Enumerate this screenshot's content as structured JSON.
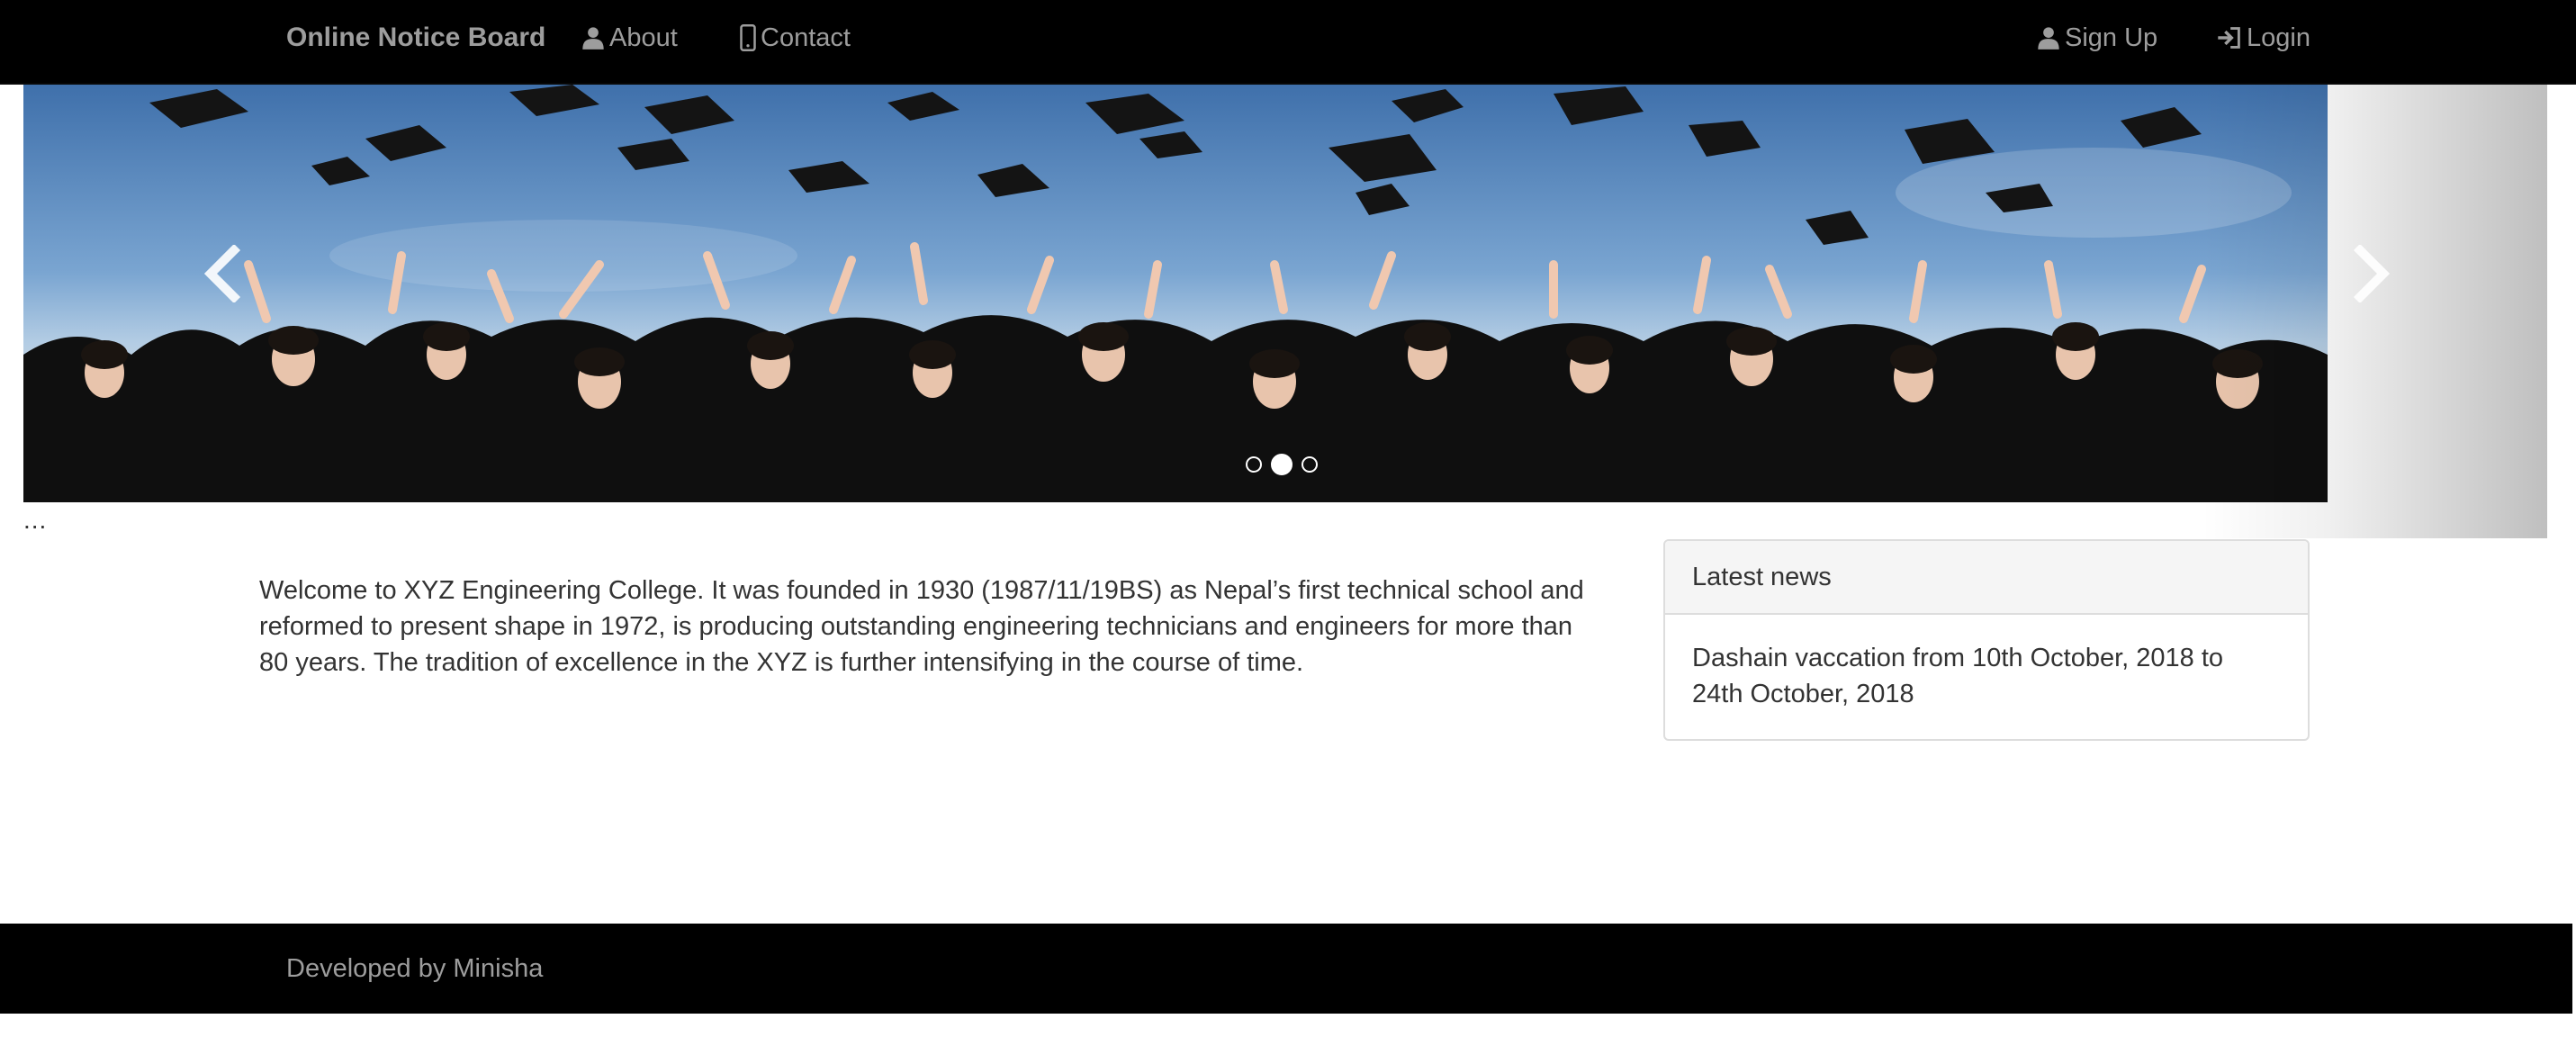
{
  "navbar": {
    "brand": "Online Notice Board",
    "links": [
      {
        "label": "About",
        "icon": "user-icon"
      },
      {
        "label": "Contact",
        "icon": "phone-icon"
      }
    ],
    "right_links": [
      {
        "label": "Sign Up",
        "icon": "user-icon"
      },
      {
        "label": "Login",
        "icon": "login-icon"
      }
    ]
  },
  "carousel": {
    "image": "graduates throwing caps photo",
    "prev_icon": "chevron-left-icon",
    "next_icon": "chevron-right-icon",
    "slide_count": 3,
    "active_slide": 2,
    "caption": "..."
  },
  "main": {
    "welcome_text": "Welcome to XYZ Engineering College. It was founded in 1930 (1987/11/19BS) as Nepal’s first technical school and reformed to present shape in 1972, is producing outstanding engineering technicians and engineers for more than 80 years. The tradition of excellence in the XYZ is further intensifying in the course of time."
  },
  "news_panel": {
    "heading": "Latest news",
    "items": [
      "Dashain vaccation from 10th October, 2018 to 24th October, 2018"
    ]
  },
  "footer": {
    "text": "Developed by Minisha"
  },
  "colors": {
    "navbar_bg": "#000000",
    "nav_text": "#9d9d9d",
    "panel_heading_bg": "#f5f5f5",
    "border": "#dddddd"
  }
}
